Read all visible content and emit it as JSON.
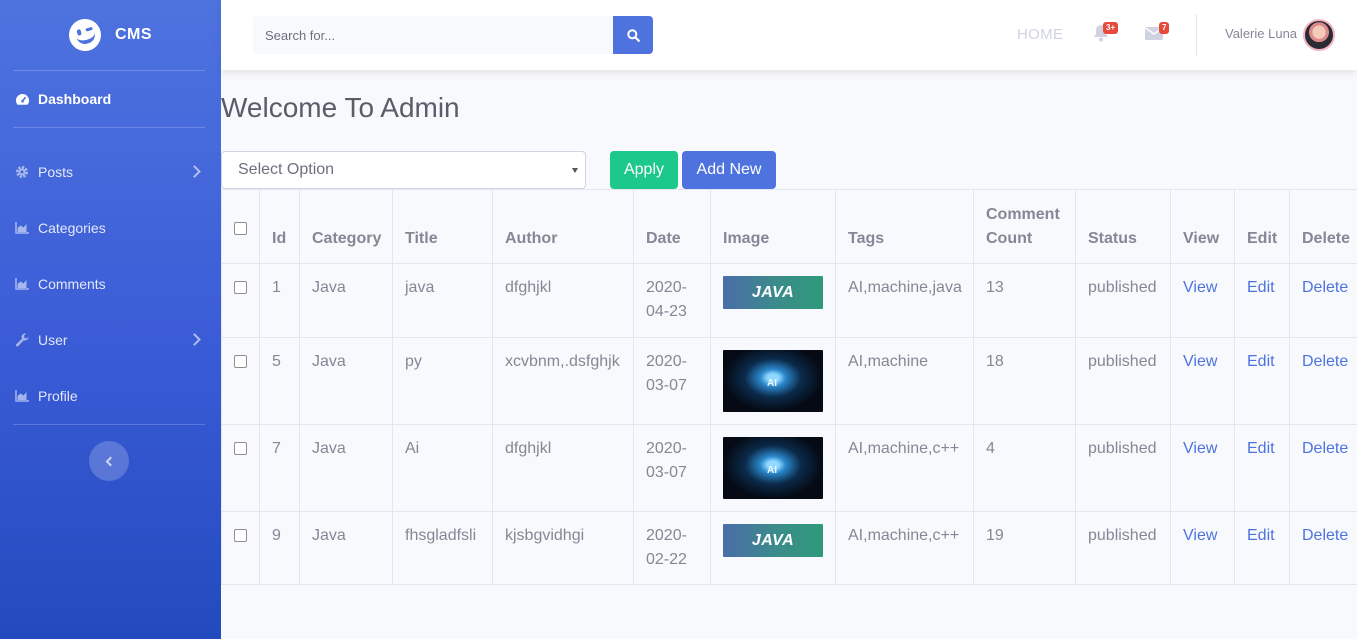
{
  "sidebar": {
    "brand": "CMS",
    "items": [
      {
        "label": "Dashboard",
        "icon": "tachometer-icon"
      },
      {
        "label": "Posts",
        "icon": "gear-icon"
      },
      {
        "label": "Categories",
        "icon": "chart-area-icon"
      },
      {
        "label": "Comments",
        "icon": "chart-area-icon"
      },
      {
        "label": "User",
        "icon": "wrench-icon"
      },
      {
        "label": "Profile",
        "icon": "chart-area-icon"
      }
    ]
  },
  "topbar": {
    "search_placeholder": "Search for...",
    "home_label": "HOME",
    "alerts_count": "3+",
    "messages_count": "7",
    "user_name": "Valerie Luna"
  },
  "main": {
    "title": "Welcome To Admin",
    "select_value": "Select Option",
    "apply_label": "Apply",
    "add_new_label": "Add New"
  },
  "table": {
    "headers": [
      "Id",
      "Category",
      "Title",
      "Author",
      "Date",
      "Image",
      "Tags",
      "Comment Count",
      "Status",
      "View",
      "Edit",
      "Delete"
    ],
    "rows": [
      {
        "id": "1",
        "category": "Java",
        "title": "java",
        "author": "dfghjkl",
        "date": "2020-04-23",
        "image": "JAVA",
        "tags": "AI,machine,java",
        "comments": "13",
        "status": "published",
        "view": "View",
        "edit": "Edit",
        "delete": "Delete"
      },
      {
        "id": "5",
        "category": "Java",
        "title": "py",
        "author": "xcvbnm,.dsfghjk",
        "date": "2020-03-07",
        "image": "AI",
        "tags": "AI,machine",
        "comments": "18",
        "status": "published",
        "view": "View",
        "edit": "Edit",
        "delete": "Delete"
      },
      {
        "id": "7",
        "category": "Java",
        "title": "Ai",
        "author": "dfghjkl",
        "date": "2020-03-07",
        "image": "AI",
        "tags": "AI,machine,c++",
        "comments": "4",
        "status": "published",
        "view": "View",
        "edit": "Edit",
        "delete": "Delete"
      },
      {
        "id": "9",
        "category": "Java",
        "title": "fhsgladfsli",
        "author": "kjsbgvidhgi",
        "date": "2020-02-22",
        "image": "JAVA",
        "tags": "AI,machine,c++",
        "comments": "19",
        "status": "published",
        "view": "View",
        "edit": "Edit",
        "delete": "Delete"
      }
    ]
  },
  "colors": {
    "primary": "#4e73df",
    "success": "#1cc88a",
    "danger": "#e74a3b",
    "text": "#858796"
  }
}
